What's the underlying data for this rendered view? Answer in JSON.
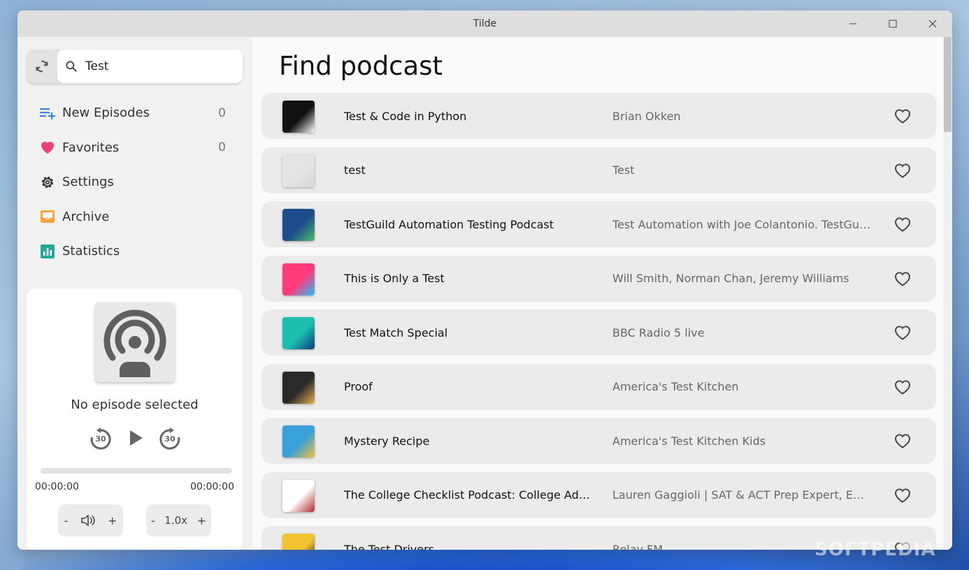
{
  "window": {
    "title": "Tilde"
  },
  "search": {
    "value": "Test"
  },
  "nav": [
    {
      "label": "New Episodes",
      "count": "0",
      "icon": "playlist-add-icon"
    },
    {
      "label": "Favorites",
      "count": "0",
      "icon": "heart-icon"
    },
    {
      "label": "Settings",
      "count": "",
      "icon": "gear-icon"
    },
    {
      "label": "Archive",
      "count": "",
      "icon": "archive-icon"
    },
    {
      "label": "Statistics",
      "count": "",
      "icon": "bar-chart-icon"
    }
  ],
  "player": {
    "status": "No episode selected",
    "rewind_label": "30",
    "forward_label": "30",
    "time_elapsed": "00:00:00",
    "time_total": "00:00:00",
    "progress": 0,
    "vol_minus": "-",
    "vol_plus": "+",
    "speed_minus": "-",
    "speed_value": "1.0x",
    "speed_plus": "+"
  },
  "main": {
    "title": "Find podcast",
    "results": [
      {
        "title": "Test & Code in Python",
        "author": "Brian Okken",
        "thumb": [
          "#111111",
          "#ffffff"
        ]
      },
      {
        "title": "test",
        "author": "Test",
        "thumb": [
          "#e4e4e4",
          "#d6d6d6"
        ]
      },
      {
        "title": "TestGuild Automation Testing Podcast",
        "author": "Test Automation with Joe Colantonio. TestGuild",
        "thumb": [
          "#1e4d8c",
          "#4bbf6b"
        ]
      },
      {
        "title": "This is Only a Test",
        "author": "Will Smith, Norman Chan, Jeremy Williams",
        "thumb": [
          "#ff3b7a",
          "#22c1ff"
        ]
      },
      {
        "title": "Test Match Special",
        "author": "BBC Radio 5 live",
        "thumb": [
          "#1bbfb0",
          "#0b3a7a"
        ]
      },
      {
        "title": "Proof",
        "author": "America's Test Kitchen",
        "thumb": [
          "#2a2a2a",
          "#e6b04a"
        ]
      },
      {
        "title": "Mystery Recipe",
        "author": "America's Test Kitchen Kids",
        "thumb": [
          "#3aa0d8",
          "#f3c13a"
        ]
      },
      {
        "title": "The College Checklist Podcast: College Admissions",
        "author": "Lauren Gaggioli | SAT & ACT Prep Expert, Entrepreneur",
        "thumb": [
          "#ffffff",
          "#b52a2a"
        ]
      },
      {
        "title": "The Test Drivers",
        "author": "Relay FM",
        "thumb": [
          "#f2c230",
          "#222222"
        ]
      }
    ]
  },
  "watermark": "SOFTPEDIA"
}
